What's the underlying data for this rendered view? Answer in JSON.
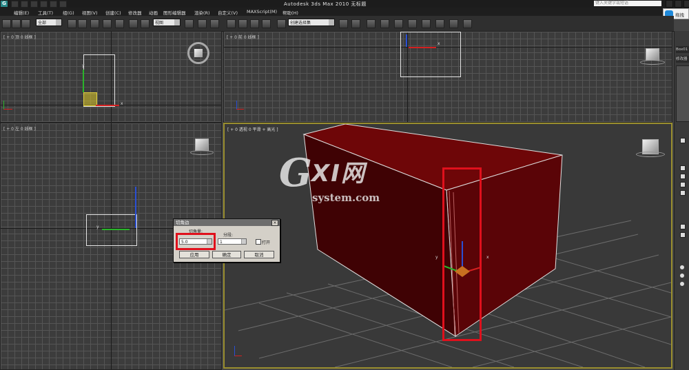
{
  "app": {
    "logo_letter": "G",
    "title": "Autodesk 3ds Max  2010    无标题",
    "search_placeholder": "键入关键字或短语"
  },
  "menu": [
    "编辑(E)",
    "工具(T)",
    "组(G)",
    "视图(V)",
    "创建(C)",
    "修改器",
    "动画",
    "图形编辑器",
    "渲染(R)",
    "自定义(V)",
    "MAXScript(M)",
    "帮助(H)"
  ],
  "login_button": "拖拽",
  "toolbar": {
    "selection_filter": "全部",
    "reference_coord": "视图",
    "named_selection": "创建选择集"
  },
  "viewports": {
    "top": "[ + 0 顶 0 线框 ]",
    "front": "[ + 0 前 0 线框 ]",
    "left": "[ + 0 左 0 线框 ]",
    "perspective": "[ + 0 透视 0 平滑 + 高光 ]"
  },
  "axes": {
    "x": "x",
    "y": "y",
    "z": "z"
  },
  "dialog": {
    "title": "切角边",
    "amount_label": "切角量:",
    "amount_value": "5.0",
    "segments_label": "分段:",
    "segments_value": "1",
    "open_label": "打开",
    "apply": "应用",
    "ok": "确定",
    "cancel": "取消"
  },
  "command_panel": {
    "object_name_field": "Box01",
    "modifier_list_label": "修改器"
  },
  "watermark": {
    "main": "XI网",
    "letter": "G",
    "sub": "system.com"
  },
  "colors": {
    "box": "#6a0406",
    "highlight": "#e0101c",
    "active_border": "#9a8f2e"
  }
}
